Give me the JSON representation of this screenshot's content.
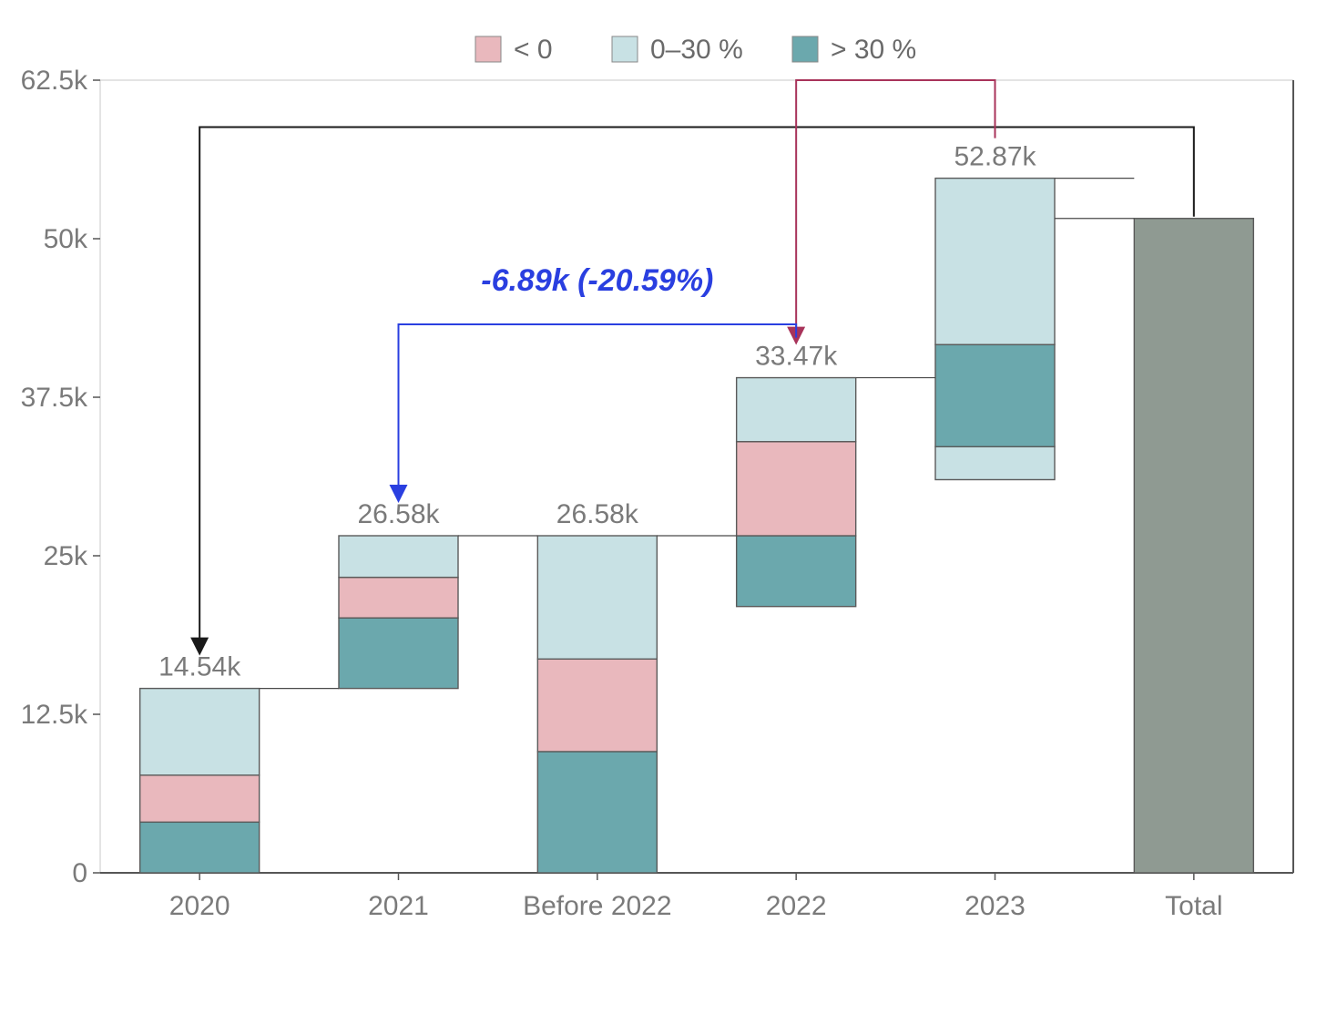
{
  "chart_data": {
    "type": "bar",
    "title": "",
    "xlabel": "",
    "ylabel": "",
    "ylim": [
      0,
      62500
    ],
    "y_ticks": [
      0,
      12500,
      25000,
      37500,
      50000,
      62500
    ],
    "y_tick_labels": [
      "0",
      "12.5k",
      "25k",
      "37.5k",
      "50k",
      "62.5k"
    ],
    "categories": [
      "2020",
      "2021",
      "Before 2022",
      "2022",
      "2023",
      "Total"
    ],
    "legend": [
      {
        "name": "< 0",
        "color": "#e9b8bd"
      },
      {
        "name": "0–30 %",
        "color": "#c8e1e4"
      },
      {
        "name": "> 30 %",
        "color": "#6ba8ad"
      }
    ],
    "bars": [
      {
        "top_label": "14.54k",
        "base": 0,
        "segments": [
          {
            "series": "> 30 %",
            "value": 4000
          },
          {
            "series": "< 0",
            "value": 3700
          },
          {
            "series": "0–30 %",
            "value": 6840
          }
        ],
        "is_summary": false
      },
      {
        "top_label": "26.58k",
        "base": 14540,
        "segments": [
          {
            "series": "> 30 %",
            "value": 5560
          },
          {
            "series": "< 0",
            "value": 3200
          },
          {
            "series": "0–30 %",
            "value": 3280
          }
        ],
        "is_summary": false
      },
      {
        "top_label": "26.58k",
        "base": 0,
        "segments": [
          {
            "series": "> 30 %",
            "value": 9560
          },
          {
            "series": "< 0",
            "value": 7300
          },
          {
            "series": "0–30 %",
            "value": 9720
          }
        ],
        "is_summary": true
      },
      {
        "top_label": "33.47k",
        "base": 21000,
        "segments": [
          {
            "series": "> 30 %",
            "value": 5580
          },
          {
            "series": "< 0",
            "value": 7420
          },
          {
            "series": "0–30 %",
            "value": 5040
          }
        ],
        "is_summary": false
      },
      {
        "top_label": "52.87k",
        "base": 31000,
        "segments": [
          {
            "series": "0–30 %",
            "value": 2600
          },
          {
            "series": "> 30 %",
            "value": 8050
          },
          {
            "series": "0–30 %",
            "value": 13120
          }
        ],
        "is_summary": false
      },
      {
        "top_label": "",
        "base": 0,
        "segments": [
          {
            "series": "Total",
            "value": 51600
          }
        ],
        "is_summary": true
      }
    ],
    "connectors": [
      {
        "from_bar": 0,
        "to_bar": 1
      },
      {
        "from_bar": 1,
        "to_bar": 2
      },
      {
        "from_bar": 2,
        "to_bar": 3
      },
      {
        "from_bar": 3,
        "to_bar": 4
      },
      {
        "from_bar": 4,
        "to_bar": 5
      }
    ],
    "callouts": [
      {
        "text": "-6.89k (-20.59%)",
        "color": "#2a3fe0",
        "from_bar": 3,
        "to_bar": 1,
        "height_y": 43250,
        "label_y": 45900
      },
      {
        "text": "",
        "color": "#a8335a",
        "from_bar": 4,
        "to_bar": 3,
        "height_y": 62500
      },
      {
        "text": "",
        "color": "#1a1a1a",
        "from_bar": 5,
        "to_bar": 0,
        "height_y": 58800
      }
    ],
    "colors": {
      "< 0": "#e9b8bd",
      "0–30 %": "#c8e1e4",
      "> 30 %": "#6ba8ad",
      "Total": "#8f9a92",
      "stroke": "#5a5a5a"
    }
  }
}
